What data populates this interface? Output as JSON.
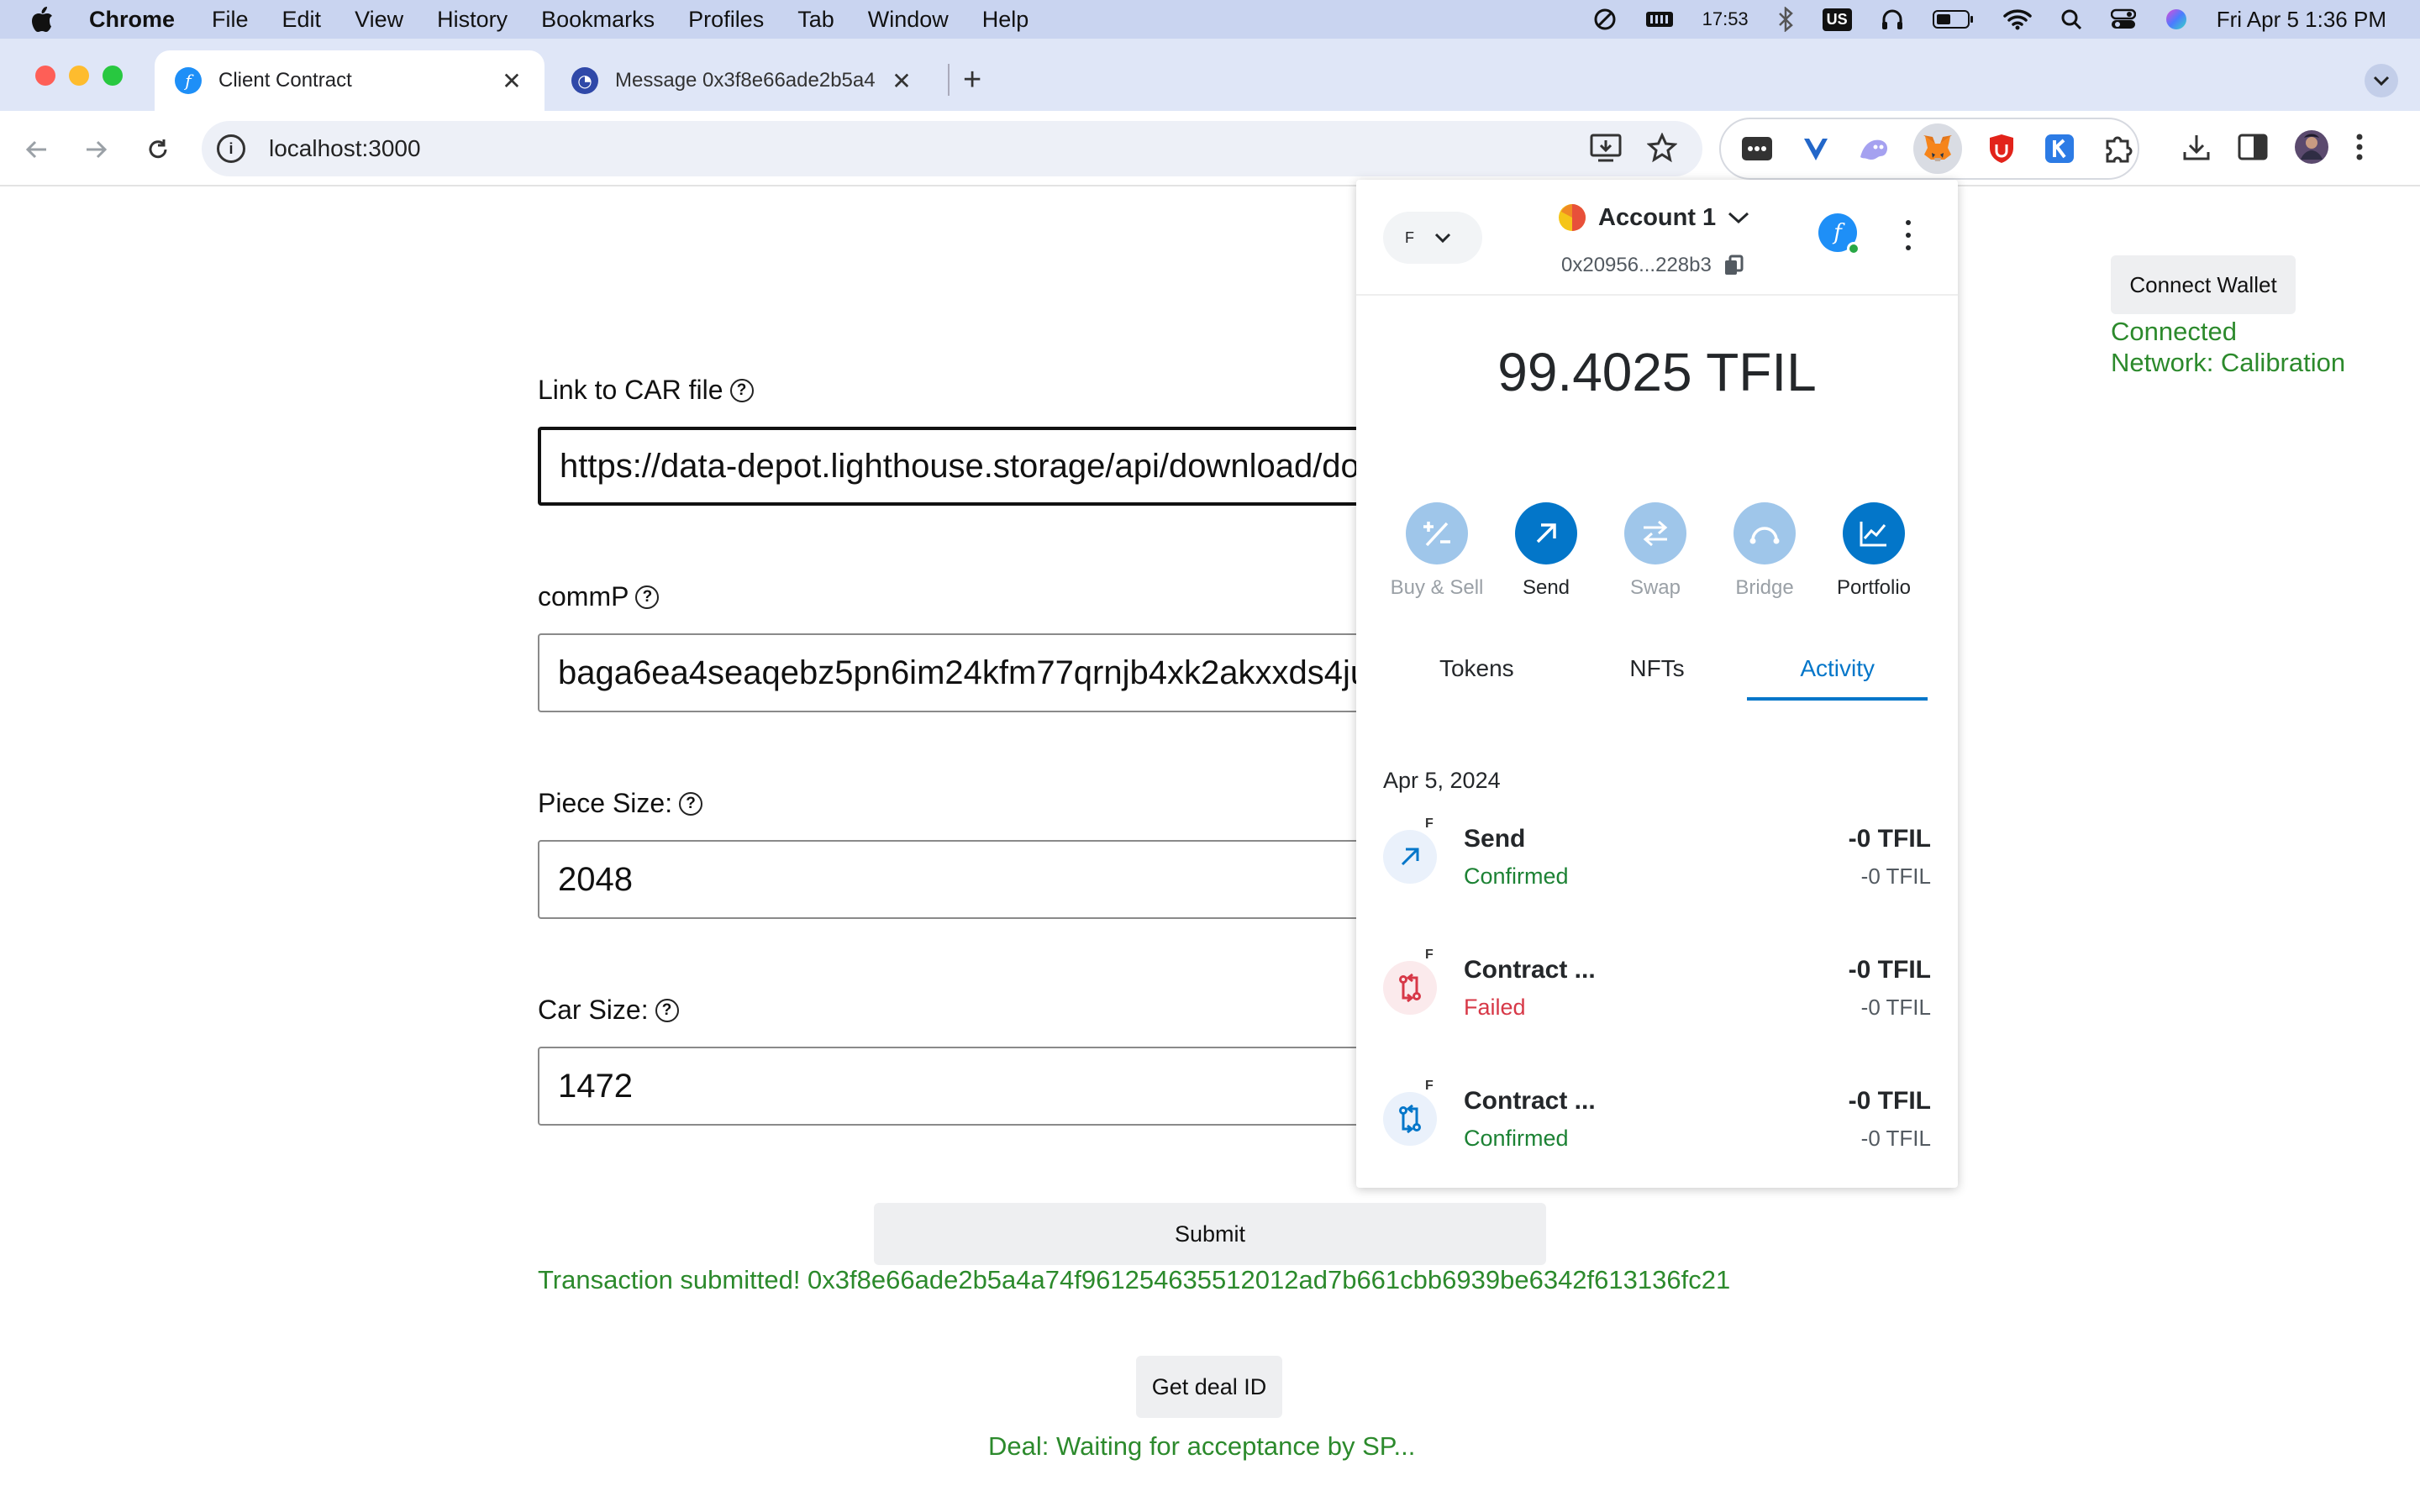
{
  "menubar": {
    "app_name": "Chrome",
    "items": [
      "File",
      "Edit",
      "View",
      "History",
      "Bookmarks",
      "Profiles",
      "Tab",
      "Window",
      "Help"
    ],
    "status": {
      "time_small": "17:53",
      "keyboard": "US",
      "datetime": "Fri Apr 5  1:36 PM"
    }
  },
  "tabs": [
    {
      "title": "Client Contract",
      "active": true
    },
    {
      "title": "Message 0x3f8e66ade2b5a4",
      "active": false
    }
  ],
  "toolbar": {
    "url": "localhost:3000"
  },
  "form": {
    "car_link": {
      "label": "Link to CAR file",
      "value": "https://data-depot.lighthouse.storage/api/download/do"
    },
    "commp": {
      "label": "commP",
      "value": "baga6ea4seaqebz5pn6im24kfm77qrnjb4xk2akxxds4ju"
    },
    "piece_size": {
      "label": "Piece Size:",
      "value": "2048"
    },
    "car_size": {
      "label": "Car Size:",
      "value": "1472"
    },
    "submit_label": "Submit",
    "tx_message": "Transaction submitted! 0x3f8e66ade2b5a4a74f961254635512012ad7b661cbb6939be6342f613136fc21",
    "deal_button": "Get deal ID",
    "deal_message": "Deal: Waiting for acceptance by SP..."
  },
  "wallet": {
    "connect_label": "Connect Wallet",
    "status": "Connected",
    "network": "Network: Calibration"
  },
  "metamask": {
    "network_badge": "F",
    "account_name": "Account 1",
    "address": "0x20956...228b3",
    "balance": "99.4025 TFIL",
    "actions": [
      "Buy & Sell",
      "Send",
      "Swap",
      "Bridge",
      "Portfolio"
    ],
    "tabs": [
      "Tokens",
      "NFTs",
      "Activity"
    ],
    "activity_date": "Apr 5, 2024",
    "activity": [
      {
        "title": "Send",
        "status": "Confirmed",
        "amount": "-0 TFIL",
        "amount_sub": "-0 TFIL"
      },
      {
        "title": "Contract ...",
        "status": "Failed",
        "amount": "-0 TFIL",
        "amount_sub": "-0 TFIL"
      },
      {
        "title": "Contract ...",
        "status": "Confirmed",
        "amount": "-0 TFIL",
        "amount_sub": "-0 TFIL"
      }
    ],
    "activity_badge": "F"
  },
  "icons": {
    "apple": "apple-icon",
    "back": "back-arrow-icon",
    "forward": "forward-arrow-icon",
    "reload": "reload-icon",
    "info": "site-info-icon",
    "install": "install-app-icon",
    "star": "bookmark-star-icon",
    "metamask": "metamask-fox-icon",
    "extensions": "puzzle-icon",
    "download": "download-icon",
    "sidepanel": "side-panel-icon",
    "profile": "avatar",
    "menu": "kebab-menu-icon",
    "copy": "copy-icon"
  },
  "colors": {
    "accent_blue": "#0376c9",
    "success_green": "#2c8a2c",
    "failed_red": "#d73847",
    "menubar": "#c9d4f0",
    "tabstrip": "#dfe6f7"
  }
}
